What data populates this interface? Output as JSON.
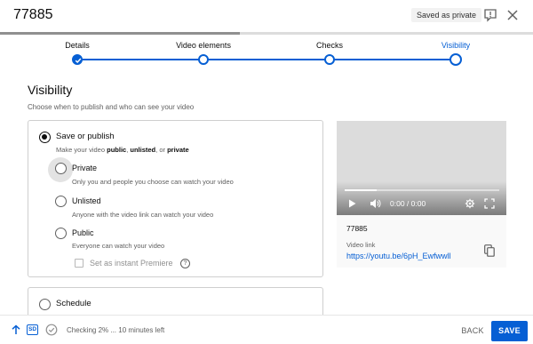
{
  "header": {
    "title": "77885",
    "saved_badge": "Saved as private",
    "feedback_icon": "flag-feedback-icon",
    "close_icon": "close-icon"
  },
  "upload_progress": 0.45,
  "steps": [
    {
      "label": "Details",
      "state": "done"
    },
    {
      "label": "Video elements",
      "state": "todo"
    },
    {
      "label": "Checks",
      "state": "todo"
    },
    {
      "label": "Visibility",
      "state": "active"
    }
  ],
  "visibility": {
    "title": "Visibility",
    "subtitle": "Choose when to publish and who can see your video",
    "save_or_publish": {
      "label": "Save or publish",
      "desc_prefix": "Make your video ",
      "desc_public": "public",
      "desc_sep1": ", ",
      "desc_unlisted": "unlisted",
      "desc_sep2": ", or ",
      "desc_private": "private",
      "selected": true
    },
    "options": [
      {
        "label": "Private",
        "desc": "Only you and people you choose can watch your video",
        "selected": false
      },
      {
        "label": "Unlisted",
        "desc": "Anyone with the video link can watch your video",
        "selected": false
      },
      {
        "label": "Public",
        "desc": "Everyone can watch your video",
        "selected": false
      }
    ],
    "premiere_label": "Set as instant Premiere",
    "premiere_help": "?",
    "schedule_label": "Schedule"
  },
  "preview": {
    "time": "0:00 / 0:00",
    "video_id": "77885",
    "link_label": "Video link",
    "link": "https://youtu.be/6pH_Ewfwwll"
  },
  "footer": {
    "sd_label": "SD",
    "status": "Checking 2% ... 10 minutes left",
    "back": "BACK",
    "save": "SAVE"
  },
  "colors": {
    "accent": "#065fd4",
    "text": "#0d0d0d",
    "secondary_text": "#606060"
  }
}
